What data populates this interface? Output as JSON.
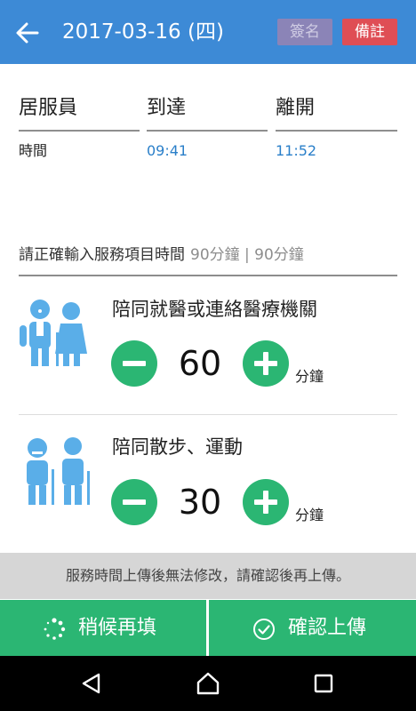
{
  "header": {
    "title": "2017-03-16 (四)",
    "sign_label": "簽名",
    "note_label": "備註"
  },
  "visit": {
    "columns": [
      "居服員",
      "到達",
      "離開"
    ],
    "row_label": "時間",
    "arrive_time": "09:41",
    "leave_time": "11:52"
  },
  "hint": {
    "text": "請正確輸入服務項目時間",
    "sub": "90分鐘 | 90分鐘"
  },
  "services": [
    {
      "title": "陪同就醫或連絡醫療機關",
      "qty": "60",
      "unit": "分鐘",
      "icon": "doctor-patient-icon"
    },
    {
      "title": "陪同散步、運動",
      "qty": "30",
      "unit": "分鐘",
      "icon": "elderly-walk-icon"
    }
  ],
  "notice": "服務時間上傳後無法修改，請確認後再上傳。",
  "actions": {
    "later_label": "稍候再填",
    "confirm_label": "確認上傳"
  },
  "colors": {
    "appbar": "#3d8ad6",
    "accent_green": "#2bb673",
    "note_red": "#df4e55",
    "sign_purple": "#8b84b7",
    "time_blue": "#2a7fc9"
  }
}
